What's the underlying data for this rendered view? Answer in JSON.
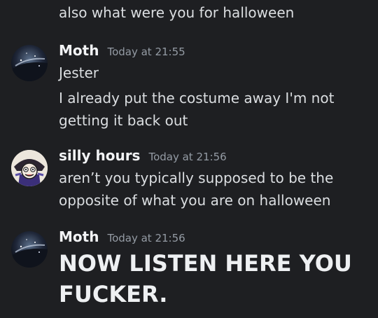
{
  "messages": {
    "prev_line": "also what were you for halloween",
    "m1": {
      "author": "Moth",
      "timestamp": "Today at 21:55",
      "lines": [
        "Jester",
        "I already put the costume away I'm not getting it back out"
      ]
    },
    "m2": {
      "author": "silly hours",
      "timestamp": "Today at 21:56",
      "lines": [
        "aren’t you typically supposed to be the opposite of what you are on halloween"
      ]
    },
    "m3": {
      "author": "Moth",
      "timestamp": "Today at 21:56",
      "lines": [
        "NOW LISTEN HERE YOU FUCKER."
      ]
    }
  },
  "colors": {
    "background": "#1e1f22",
    "text": "#dbdee1",
    "timestamp": "#949ba4"
  }
}
